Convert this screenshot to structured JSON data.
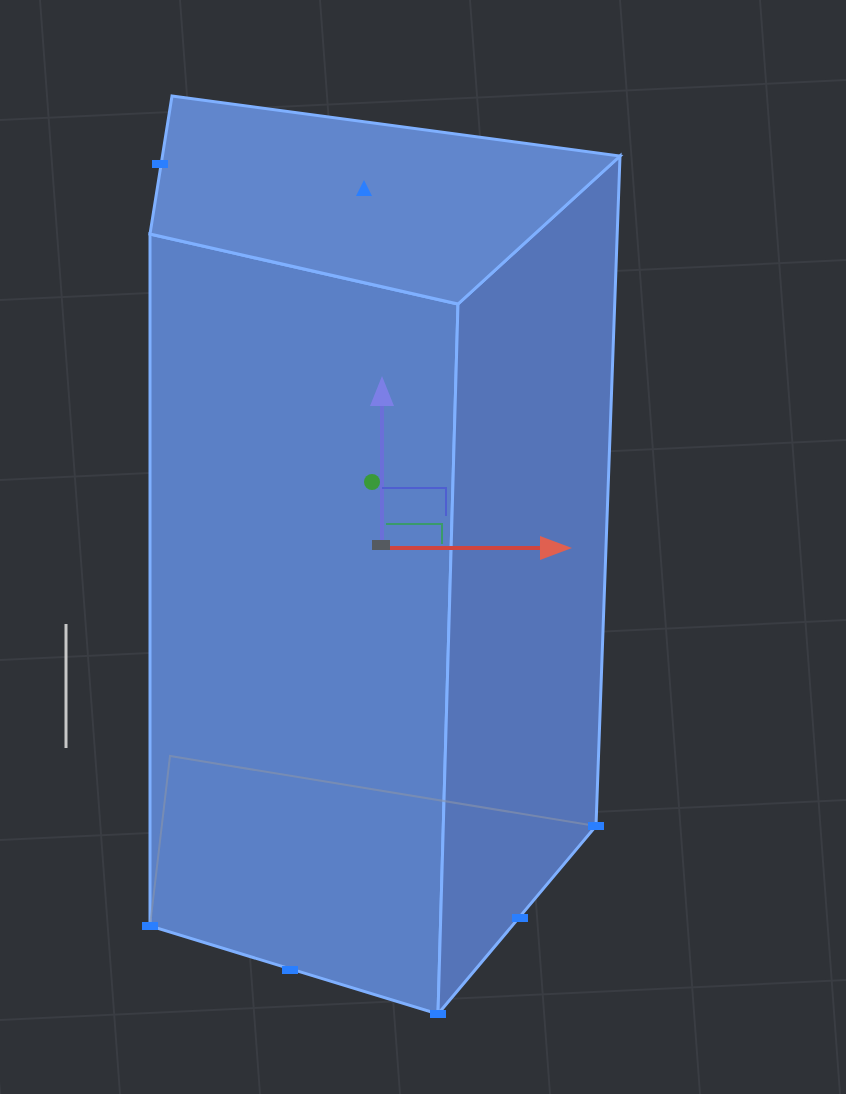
{
  "viewport": {
    "object": {
      "kind": "box",
      "selected": true
    }
  }
}
